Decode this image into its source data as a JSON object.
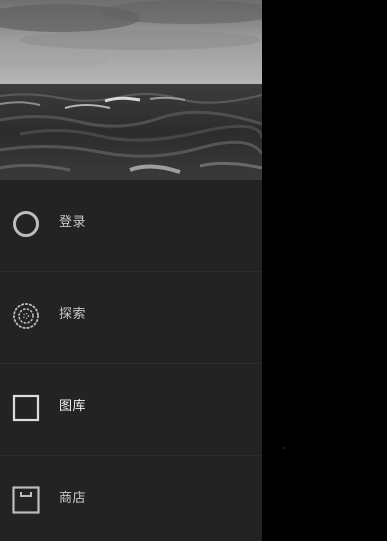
{
  "drawer": {
    "items": [
      {
        "label": "登录",
        "icon": "circle-icon"
      },
      {
        "label": "探索",
        "icon": "dotted-circle-icon"
      },
      {
        "label": "图库",
        "icon": "square-icon"
      },
      {
        "label": "商店",
        "icon": "store-box-icon"
      }
    ],
    "active_index": 2
  },
  "colors": {
    "drawer_bg": "#232323",
    "scrim": "#000000",
    "divider": "#2e2e2e",
    "label": "#c9c9c9",
    "label_active": "#f2f2f2",
    "icon": "#bdbdbd"
  }
}
